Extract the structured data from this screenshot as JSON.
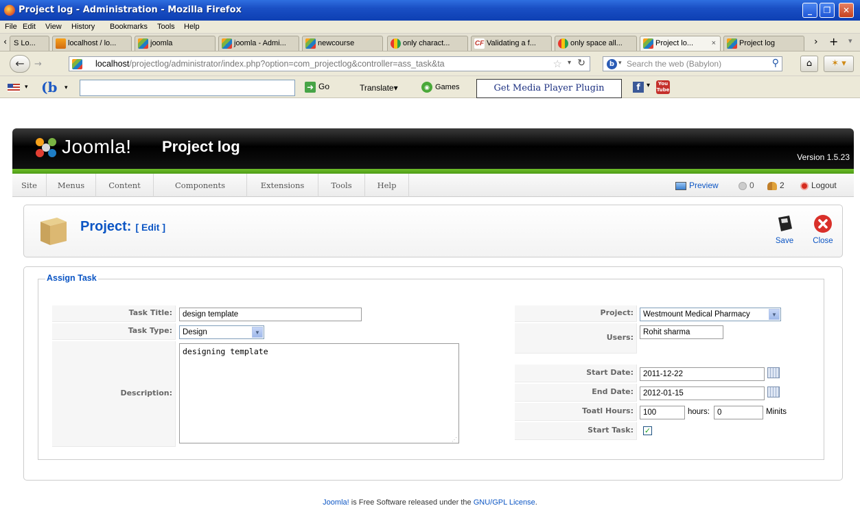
{
  "window": {
    "title": "Project log - Administration - Mozilla Firefox"
  },
  "menubar": [
    "File",
    "Edit",
    "View",
    "History",
    "Bookmarks",
    "Tools",
    "Help"
  ],
  "tabs": [
    {
      "label": "S Lo...",
      "icon": "s-icon"
    },
    {
      "label": "localhost / lo...",
      "icon": "phpmyadmin-icon"
    },
    {
      "label": "joomla",
      "icon": "joomla-icon"
    },
    {
      "label": "joomla - Admi...",
      "icon": "joomla-icon"
    },
    {
      "label": "newcourse",
      "icon": "joomla-icon"
    },
    {
      "label": "only charact...",
      "icon": "google-icon"
    },
    {
      "label": "Validating a f...",
      "icon": "cf-icon"
    },
    {
      "label": "only space all...",
      "icon": "google-icon"
    },
    {
      "label": "Project lo...",
      "icon": "joomla-icon",
      "active": true
    },
    {
      "label": "Project log",
      "icon": "joomla-icon"
    }
  ],
  "nav": {
    "url_host": "localhost",
    "url_rest": "/projectlog/administrator/index.php?option=com_projectlog&controller=ass_task&ta",
    "search_placeholder": "Search the web (Babylon)"
  },
  "babylon": {
    "go_label": "Go",
    "translate_label": "Translate",
    "games_label": "Games",
    "media_button": "Get Media Player Plugin",
    "youtube_label": "You Tube"
  },
  "joomla": {
    "logo_text": "Joomla!",
    "app_title": "Project log",
    "version": "Version 1.5.23",
    "menu": [
      "Site",
      "Menus",
      "Content",
      "Components",
      "Extensions",
      "Tools",
      "Help"
    ],
    "status": {
      "preview": "Preview",
      "messages": "0",
      "users": "2",
      "logout": "Logout"
    }
  },
  "toolbar": {
    "title": "Project:",
    "subtitle": "[ Edit ]",
    "save": "Save",
    "close": "Close"
  },
  "form": {
    "legend": "Assign Task",
    "task_title_label": "Task Title:",
    "task_title_value": "design template",
    "task_type_label": "Task Type:",
    "task_type_value": "Design",
    "description_label": "Description:",
    "description_value": "designing template",
    "project_label": "Project:",
    "project_value": "Westmount Medical Pharmacy",
    "users_label": "Users:",
    "users_value": "Rohit sharma",
    "start_date_label": "Start Date:",
    "start_date_value": "2011-12-22",
    "end_date_label": "End Date:",
    "end_date_value": "2012-01-15",
    "total_hours_label": "Toatl Hours:",
    "hours_value": "100",
    "hours_unit": "hours:",
    "minutes_value": "0",
    "minutes_unit": "Minits",
    "start_task_label": "Start Task:",
    "start_task_checked": true
  },
  "footer": {
    "joomla_link": "Joomla!",
    "text_mid": " is Free Software released under the ",
    "license_link": "GNU/GPL License",
    "text_end": "."
  }
}
